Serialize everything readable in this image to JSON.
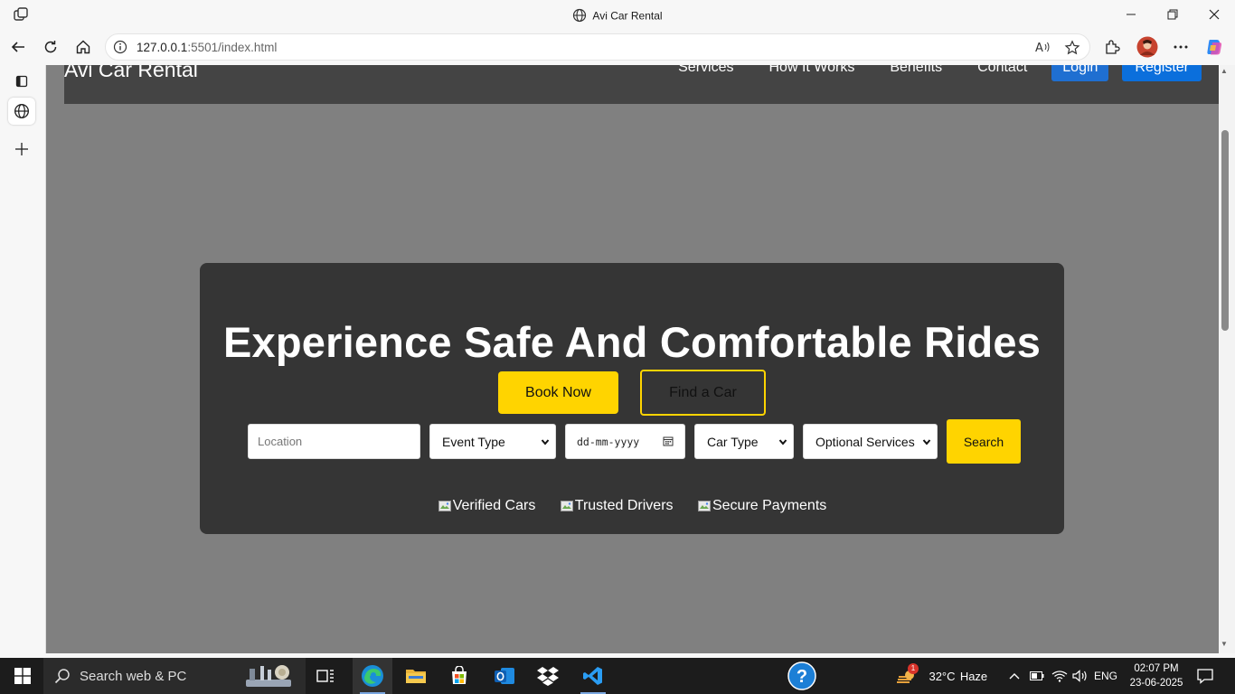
{
  "browser": {
    "tab_title": "Avi Car Rental",
    "url_host": "127.0.0.1",
    "url_rest": ":5501/index.html"
  },
  "site": {
    "brand": "Avi Car Rental",
    "nav": [
      "Services",
      "How It Works",
      "Benefits",
      "Contact"
    ],
    "login_label": "Login",
    "register_label": "Register"
  },
  "hero": {
    "heading": "Experience Safe And Comfortable Rides",
    "book_label": "Book Now",
    "find_label": "Find a Car",
    "location_placeholder": "Location",
    "event_type": "Event Type",
    "date_placeholder": "dd-mm-yyyy",
    "car_type": "Car Type",
    "optional_services": "Optional Services",
    "search_label": "Search",
    "badges": [
      "Verified Cars",
      "Trusted Drivers",
      "Secure Payments"
    ]
  },
  "taskbar": {
    "search_text": "Search web & PC",
    "weather_temp": "32°C",
    "weather_cond": "Haze",
    "weather_badge": "1",
    "language": "ENG",
    "time": "02:07 PM",
    "date": "23-06-2025"
  },
  "colors": {
    "accent_yellow": "#ffd400",
    "header_gray": "#444444",
    "hero_panel": "#353535",
    "page_bg": "#808080",
    "login_blue": "#1f6fd1"
  }
}
